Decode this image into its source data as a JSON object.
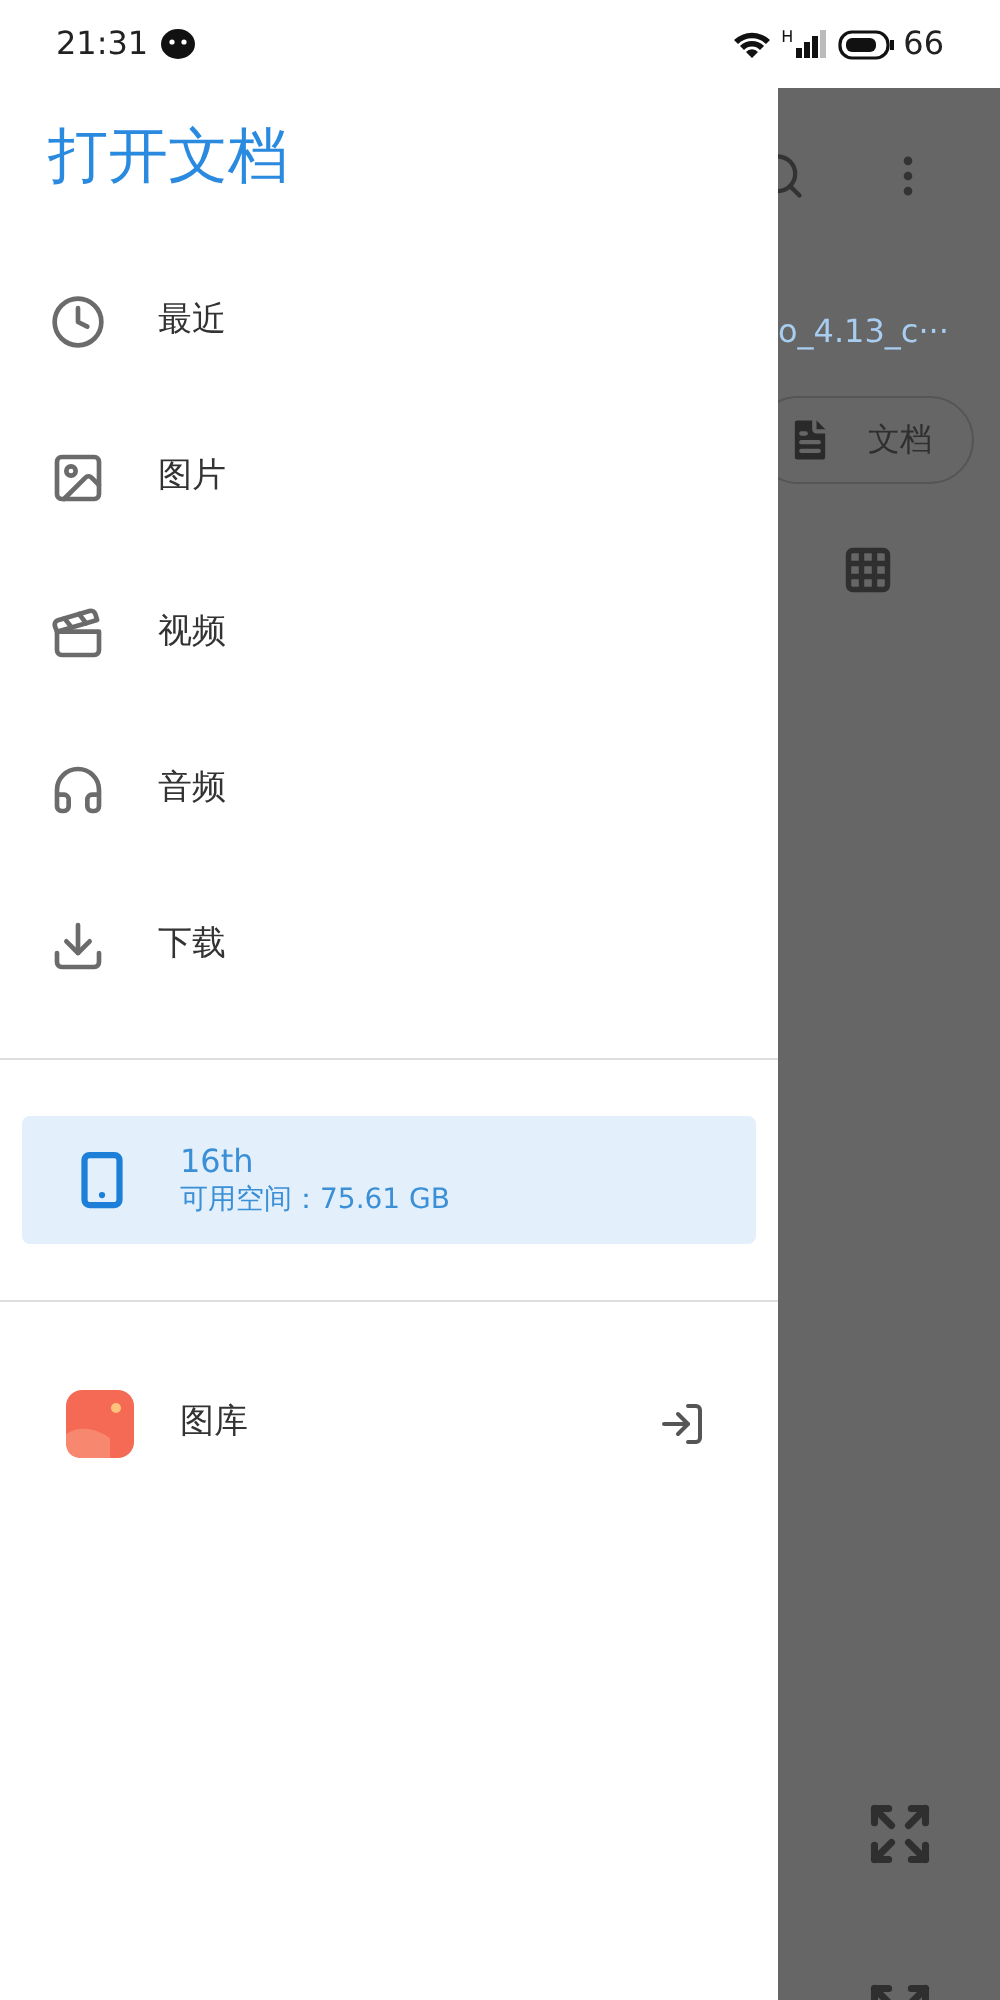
{
  "status_bar": {
    "time": "21:31",
    "network": "H",
    "battery": "66"
  },
  "drawer": {
    "title": "打开文档",
    "items": [
      {
        "label": "最近",
        "selected": false
      },
      {
        "label": "图片",
        "selected": false
      },
      {
        "label": "视频",
        "selected": false
      },
      {
        "label": "音频",
        "selected": false
      },
      {
        "label": "下载",
        "selected": false
      }
    ],
    "storage": [
      {
        "name": "16th",
        "detail": "可用空间：75.61 GB",
        "selected": true
      }
    ],
    "apps": [
      {
        "label": "图库",
        "selected": false
      }
    ]
  },
  "background": {
    "file_name": "o_4.13_c···",
    "chip": "文档"
  }
}
